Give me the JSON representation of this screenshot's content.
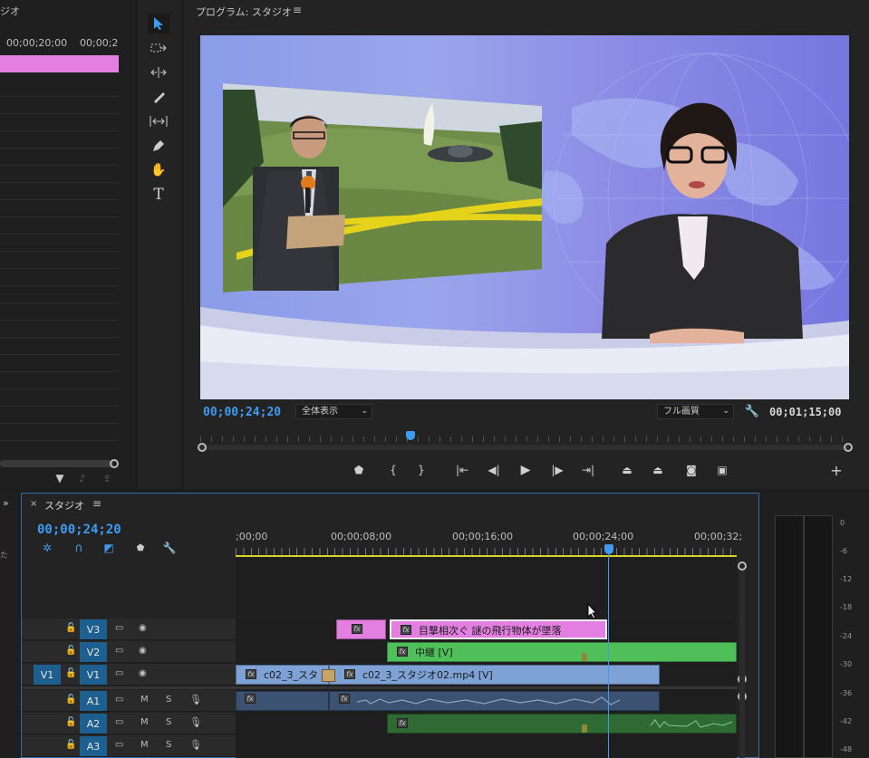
{
  "source_panel": {
    "title": "スタジオ",
    "times": [
      "00;00;20;00",
      "00;00;2"
    ]
  },
  "program_monitor": {
    "title": "プログラム: スタジオ",
    "current_time": "00;00;24;20",
    "zoom": "全体表示",
    "quality": "フル画質",
    "duration": "00;01;15;00",
    "playhead_fraction": 0.33
  },
  "tools": [
    "selection",
    "track-select",
    "ripple-edit",
    "razor",
    "slip",
    "pen",
    "hand",
    "type"
  ],
  "timeline": {
    "tab": "スタジオ",
    "current_time": "00;00;24;20",
    "ruler": [
      ";00;00",
      "00;00;08;00",
      "00;00;16;00",
      "00;00;24;00",
      "00;00;32;"
    ],
    "tracks": [
      {
        "id": "V3",
        "type": "video"
      },
      {
        "id": "V2",
        "type": "video"
      },
      {
        "id": "V1",
        "type": "video",
        "source": "V1"
      },
      {
        "id": "A1",
        "type": "audio"
      },
      {
        "id": "A2",
        "type": "audio"
      },
      {
        "id": "A3",
        "type": "audio"
      }
    ],
    "clips": {
      "v3_title": "目撃相次ぐ 謎の飛行物体が墜落",
      "v2_clip": "中継 [V]",
      "v1_clip_a": "c02_3_スタ",
      "v1_clip_b": "c02_3_スタジオ02.mp4 [V]"
    },
    "mute": "M",
    "solo": "S"
  },
  "audio_meter": {
    "labels": [
      "0",
      "-6",
      "-12",
      "-18",
      "-24",
      "-30",
      "-36",
      "-42",
      "-48"
    ]
  },
  "colors": {
    "accent": "#3f9bf2",
    "pink": "#e27fe0",
    "green": "#4fbf5a",
    "blue_clip": "#7ea2d6",
    "audio": "#3b5273"
  }
}
